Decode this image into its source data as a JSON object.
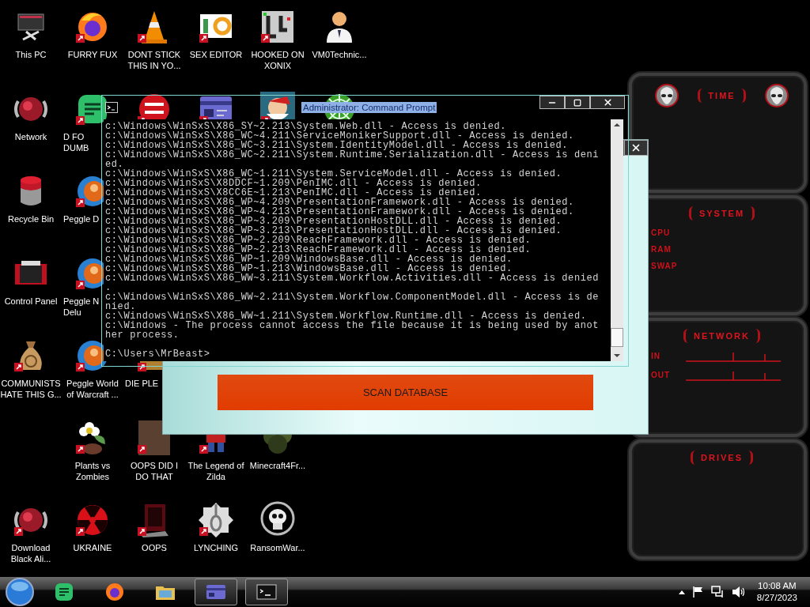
{
  "desktop_icons": [
    {
      "kind": "monitor",
      "label": "This PC",
      "shortcut": false
    },
    {
      "kind": "browser",
      "label": "FURRY FUX",
      "shortcut": true
    },
    {
      "kind": "cone",
      "label": "DONT STICK THIS IN YO...",
      "shortcut": true
    },
    {
      "kind": "editor",
      "label": "SEX EDITOR",
      "shortcut": true
    },
    {
      "kind": "maze",
      "label": "HOOKED ON XONIX",
      "shortcut": true
    },
    {
      "kind": "person",
      "label": "VM0Technic...",
      "shortcut": false
    },
    {
      "kind": "globe",
      "label": "Network",
      "shortcut": false
    },
    {
      "kind": "document",
      "label": "D FO DUMB",
      "shortcut": true,
      "clipped": true
    },
    {
      "kind": "round_logo",
      "shortcut": true
    },
    {
      "kind": "card",
      "shortcut": true
    },
    {
      "kind": "cartoon",
      "shortcut": true
    },
    {
      "kind": "wheel",
      "shortcut": false
    },
    {
      "kind": "bin",
      "label": "Recycle Bin",
      "shortcut": false
    },
    {
      "kind": "ball",
      "label": "Peggle D",
      "shortcut": true,
      "clipped": true
    },
    {
      "kind": "panel",
      "label": "Control Panel",
      "shortcut": false
    },
    {
      "kind": "ball",
      "label": "Peggle N Delu",
      "shortcut": true,
      "clipped": true
    },
    {
      "kind": "money",
      "label": "COMMUNISTS HATE THIS G...",
      "shortcut": true
    },
    {
      "kind": "ball",
      "label": "Peggle World of Warcraft ...",
      "shortcut": true
    },
    {
      "kind": "box",
      "label": "DIE PLE",
      "shortcut": true,
      "clipped": true
    },
    {
      "kind": "flower",
      "label": "Plants vs Zombies",
      "shortcut": true
    },
    {
      "kind": "painting",
      "label": "OOPS DID I DO THAT",
      "shortcut": true
    },
    {
      "kind": "pixel",
      "label": "The Legend of Zilda",
      "shortcut": true
    },
    {
      "kind": "bush",
      "label": "Minecraft4Fr...",
      "shortcut": false
    },
    {
      "kind": "globe",
      "label": "Download Black Ali...",
      "shortcut": true
    },
    {
      "kind": "radiation",
      "label": "UKRAINE",
      "shortcut": true
    },
    {
      "kind": "screen",
      "label": "OOPS",
      "shortcut": true
    },
    {
      "kind": "noose",
      "label": "LYNCHING",
      "shortcut": true
    },
    {
      "kind": "skull",
      "label": "RansomWar...",
      "shortcut": false
    }
  ],
  "gadget": {
    "panels": [
      {
        "kind": "time",
        "title": "TIME"
      },
      {
        "kind": "system",
        "title": "SYSTEM",
        "rows": [
          "CPU",
          "RAM",
          "SWAP"
        ]
      },
      {
        "kind": "network",
        "title": "NETWORK",
        "rows": [
          "IN",
          "OUT"
        ]
      },
      {
        "kind": "drives",
        "title": "DRIVES"
      }
    ]
  },
  "scan_window": {
    "button": "SCAN DATABASE"
  },
  "cmd_window": {
    "title": "Administrator: Command Prompt",
    "title_highlighted": true,
    "lines": [
      "c:\\Windows\\WinSxS\\X86_SY~2.213\\System.Web.dll - Access is denied.",
      "c:\\Windows\\WinSxS\\X86_WC~4.211\\ServiceMonikerSupport.dll - Access is denied.",
      "c:\\Windows\\WinSxS\\X86_WC~3.211\\System.IdentityModel.dll - Access is denied.",
      "c:\\Windows\\WinSxS\\X86_WC~2.211\\System.Runtime.Serialization.dll - Access is deni",
      "ed.",
      "c:\\Windows\\WinSxS\\X86_WC~1.211\\System.ServiceModel.dll - Access is denied.",
      "c:\\Windows\\WinSxS\\X8DDCF~1.209\\PenIMC.dll - Access is denied.",
      "c:\\Windows\\WinSxS\\X8CC6E~1.213\\PenIMC.dll - Access is denied.",
      "c:\\Windows\\WinSxS\\X86_WP~4.209\\PresentationFramework.dll - Access is denied.",
      "c:\\Windows\\WinSxS\\X86_WP~4.213\\PresentationFramework.dll - Access is denied.",
      "c:\\Windows\\WinSxS\\X86_WP~3.209\\PresentationHostDLL.dll - Access is denied.",
      "c:\\Windows\\WinSxS\\X86_WP~3.213\\PresentationHostDLL.dll - Access is denied.",
      "c:\\Windows\\WinSxS\\X86_WP~2.209\\ReachFramework.dll - Access is denied.",
      "c:\\Windows\\WinSxS\\X86_WP~2.213\\ReachFramework.dll - Access is denied.",
      "c:\\Windows\\WinSxS\\X86_WP~1.209\\WindowsBase.dll - Access is denied.",
      "c:\\Windows\\WinSxS\\X86_WP~1.213\\WindowsBase.dll - Access is denied.",
      "c:\\Windows\\WinSxS\\X86_WW~3.211\\System.Workflow.Activities.dll - Access is denied",
      ".",
      "c:\\Windows\\WinSxS\\X86_WW~2.211\\System.Workflow.ComponentModel.dll - Access is de",
      "nied.",
      "c:\\Windows\\WinSxS\\X86_WW~1.211\\System.Workflow.Runtime.dll - Access is denied.",
      "c:\\Windows - The process cannot access the file because it is being used by anot",
      "her process."
    ],
    "prompt": "C:\\Users\\MrBeast>"
  },
  "taskbar": {
    "items": [
      {
        "kind": "document",
        "running": false
      },
      {
        "kind": "browser",
        "running": false
      },
      {
        "kind": "folder",
        "running": false
      },
      {
        "kind": "card",
        "running": true
      },
      {
        "kind": "console",
        "running": true
      }
    ],
    "clock": {
      "time": "10:08 AM",
      "date": "8/27/2023"
    }
  }
}
